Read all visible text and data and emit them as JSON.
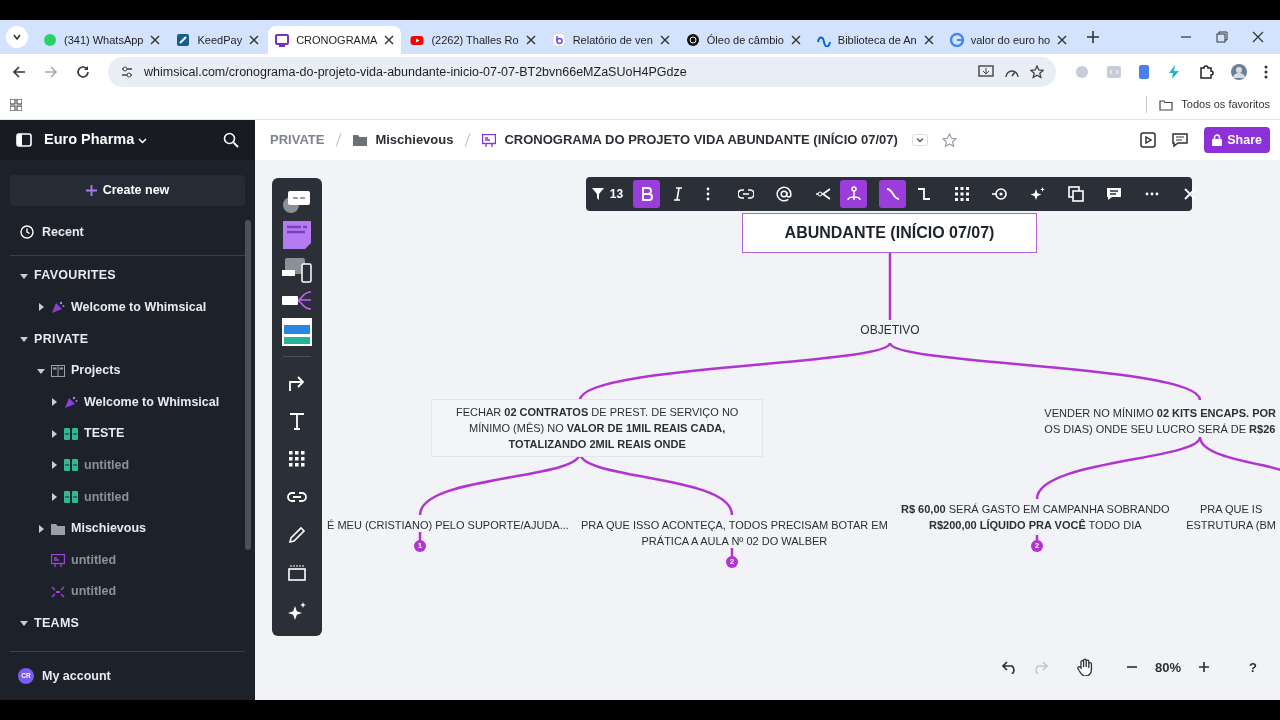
{
  "browser": {
    "tabs": [
      {
        "title": "(341) WhatsApp",
        "selected": false
      },
      {
        "title": "KeedPay",
        "selected": false
      },
      {
        "title": "CRONOGRAMA",
        "selected": true
      },
      {
        "title": "(2262) Thalles Ro",
        "selected": false
      },
      {
        "title": "Relatório de ven",
        "selected": false
      },
      {
        "title": "Óleo de câmbio",
        "selected": false
      },
      {
        "title": "Biblioteca de An",
        "selected": false
      },
      {
        "title": "valor do euro ho",
        "selected": false
      }
    ],
    "url": "whimsical.com/cronograma-do-projeto-vida-abundante-inicio-07-07-BT2bvn66eMZaSUoH4PGdze",
    "bookmarks_folder": "Todos os favoritos"
  },
  "sidebar": {
    "workspace": "Euro Pharma",
    "create_button": "Create new",
    "recent": "Recent",
    "sections": [
      {
        "label": "FAVOURITES",
        "expanded": true,
        "items": [
          {
            "label": "Welcome to Whimsical",
            "kind": "welcome",
            "expanded": false
          }
        ]
      },
      {
        "label": "PRIVATE",
        "expanded": true,
        "items": [
          {
            "label": "Projects",
            "kind": "project",
            "expanded": true,
            "children": [
              {
                "label": "Welcome to Whimsical",
                "kind": "welcome",
                "expanded": false
              },
              {
                "label": "TESTE",
                "kind": "doc",
                "expanded": false
              },
              {
                "label": "untitled",
                "kind": "doc",
                "expanded": false,
                "muted": true
              },
              {
                "label": "untitled",
                "kind": "doc",
                "expanded": false,
                "muted": true
              }
            ]
          },
          {
            "label": "Mischievous",
            "kind": "folder",
            "expanded": false
          },
          {
            "label": "untitled",
            "kind": "slides",
            "muted": true
          },
          {
            "label": "untitled",
            "kind": "mindmap",
            "muted": true
          }
        ]
      },
      {
        "label": "TEAMS",
        "expanded": true
      }
    ],
    "account": {
      "initials": "CR",
      "label": "My account"
    }
  },
  "header": {
    "breadcrumb": [
      {
        "label": "PRIVATE",
        "kind": "space"
      },
      {
        "label": "Mischievous",
        "kind": "folder"
      },
      {
        "label": "CRONOGRAMA DO PROJETO VIDA ABUNDANTE (INÍCIO 07/07)",
        "kind": "board"
      }
    ],
    "share_button": "Share"
  },
  "format_toolbar": {
    "font_size": "13",
    "toggles": [
      {
        "kind": "bold",
        "selected": true
      },
      {
        "kind": "italic",
        "selected": false
      },
      {
        "kind": "split",
        "selected": false
      },
      {
        "kind": "tree",
        "selected": true
      },
      {
        "kind": "curved",
        "selected": true
      },
      {
        "kind": "elbow",
        "selected": false
      }
    ]
  },
  "canvas": {
    "root": {
      "text": "ABUNDANTE (INÍCIO 07/07)"
    },
    "objective": "OBJETIVO",
    "nodes": [
      {
        "lines": [
          "FECHAR **02 CONTRATOS** DE PREST. DE SERVIÇO NO",
          "MÍNIMO (MÊS) NO **VALOR DE 1MIL REAIS CADA,**",
          "**TOTALIZANDO 2MIL REAIS ONDE**"
        ],
        "hovered": true
      },
      {
        "lines": [
          "VENDER NO MÍNIMO **02 KITS ENCAPS. POR**",
          "OS DIAS) ONDE SEU LUCRO SERÁ DE **R$26**"
        ],
        "hovered": false
      },
      {
        "lines": [
          "É MEU (CRISTIANO) PELO SUPORTE/AJUDA..."
        ],
        "hovered": false
      },
      {
        "lines": [
          "PRA QUE ISSO ACONTEÇA, TODOS PRECISAM BOTAR EM",
          "PRÁTICA A AULA Nº 02  DO WALBER"
        ],
        "hovered": false
      },
      {
        "lines": [
          "**R$ 60,00** SERÁ GASTO EM CAMPANHA SOBRANDO",
          "**R$200,00 LÍQUIDO PRA VOCÊ** TODO DIA"
        ],
        "hovered": false
      },
      {
        "lines": [
          "PRA QUE IS",
          "ESTRUTURA (BM"
        ],
        "hovered": false
      }
    ],
    "badges": [
      {
        "label": "1"
      },
      {
        "label": "2"
      },
      {
        "label": "2"
      }
    ]
  },
  "zoom_controls": {
    "zoom": "80%",
    "redo_disabled": true,
    "help": "?"
  }
}
